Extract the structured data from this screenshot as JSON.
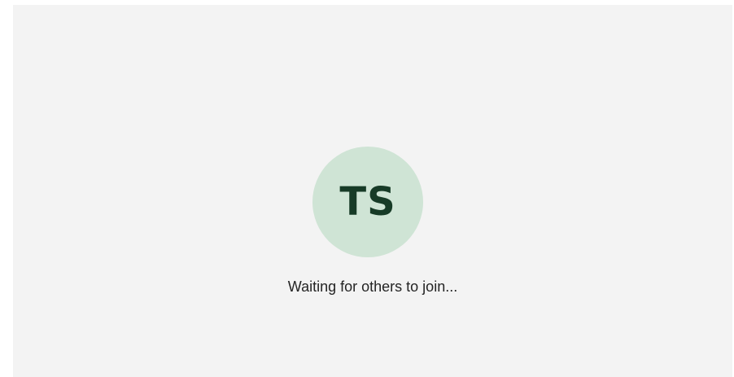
{
  "call": {
    "avatar": {
      "initials": "TS",
      "background_color": "#cfe4d5",
      "text_color": "#173b27"
    },
    "status_text": "Waiting for others to join..."
  },
  "colors": {
    "stage_background": "#f3f3f3"
  }
}
